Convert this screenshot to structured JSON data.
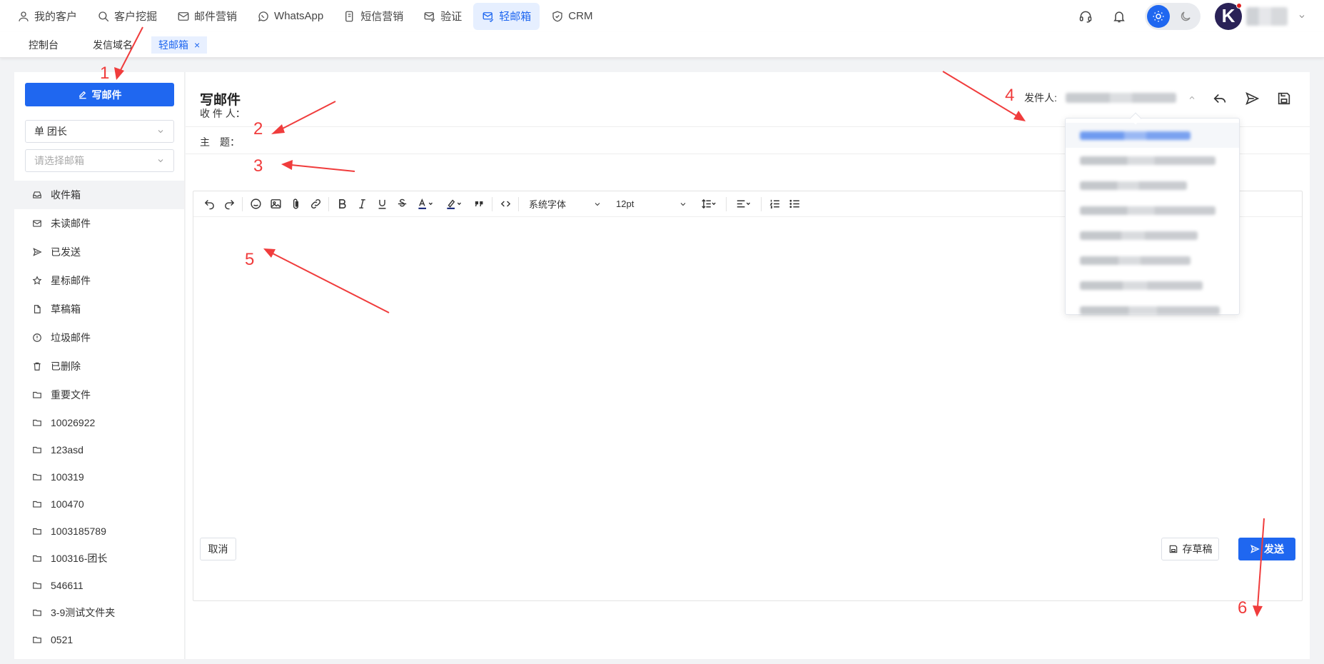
{
  "colors": {
    "accent": "#1f67f0",
    "annotation": "#f03c3c"
  },
  "nav": {
    "items": [
      {
        "label": "我的客户",
        "icon": "user-icon"
      },
      {
        "label": "客户挖掘",
        "icon": "search-icon"
      },
      {
        "label": "邮件营销",
        "icon": "mail-icon"
      },
      {
        "label": "WhatsApp",
        "icon": "whatsapp-icon"
      },
      {
        "label": "短信营销",
        "icon": "sms-icon"
      },
      {
        "label": "验证",
        "icon": "verify-mail-icon"
      },
      {
        "label": "轻邮箱",
        "icon": "light-mail-icon"
      },
      {
        "label": "CRM",
        "icon": "crm-shield-icon"
      }
    ],
    "active_index": 6,
    "avatar_letter": "K"
  },
  "tabs": [
    {
      "label": "控制台"
    },
    {
      "label": "发信域名"
    },
    {
      "label": "轻邮箱",
      "closable": true,
      "close": "×"
    }
  ],
  "sidebar": {
    "compose_label": "写邮件",
    "team_select": "单 团长",
    "mailbox_placeholder": "请选择邮箱",
    "folders": [
      {
        "label": "收件箱",
        "icon": "inbox-icon"
      },
      {
        "label": "未读邮件",
        "icon": "unread-mail-icon"
      },
      {
        "label": "已发送",
        "icon": "sent-icon"
      },
      {
        "label": "星标邮件",
        "icon": "star-icon"
      },
      {
        "label": "草稿箱",
        "icon": "draft-icon"
      },
      {
        "label": "垃圾邮件",
        "icon": "spam-icon"
      },
      {
        "label": "已删除",
        "icon": "trash-icon"
      },
      {
        "label": "重要文件",
        "icon": "folder-icon"
      },
      {
        "label": "10026922",
        "icon": "folder-icon"
      },
      {
        "label": "123asd",
        "icon": "folder-icon"
      },
      {
        "label": "100319",
        "icon": "folder-icon"
      },
      {
        "label": "100470",
        "icon": "folder-icon"
      },
      {
        "label": "1003185789",
        "icon": "folder-icon"
      },
      {
        "label": "100316-团长",
        "icon": "folder-icon"
      },
      {
        "label": "546611",
        "icon": "folder-icon"
      },
      {
        "label": "3-9测试文件夹",
        "icon": "folder-icon"
      },
      {
        "label": "0521",
        "icon": "folder-icon"
      }
    ]
  },
  "compose": {
    "title": "写邮件",
    "sender_label": "发件人:",
    "to_label": "收 件 人：",
    "subject_label": "主　题：",
    "font_family": "系统字体",
    "font_size": "12pt",
    "cancel_label": "取消",
    "draft_label": "存草稿",
    "send_label": "发送"
  },
  "annotations": [
    "1",
    "2",
    "3",
    "4",
    "5",
    "6"
  ]
}
